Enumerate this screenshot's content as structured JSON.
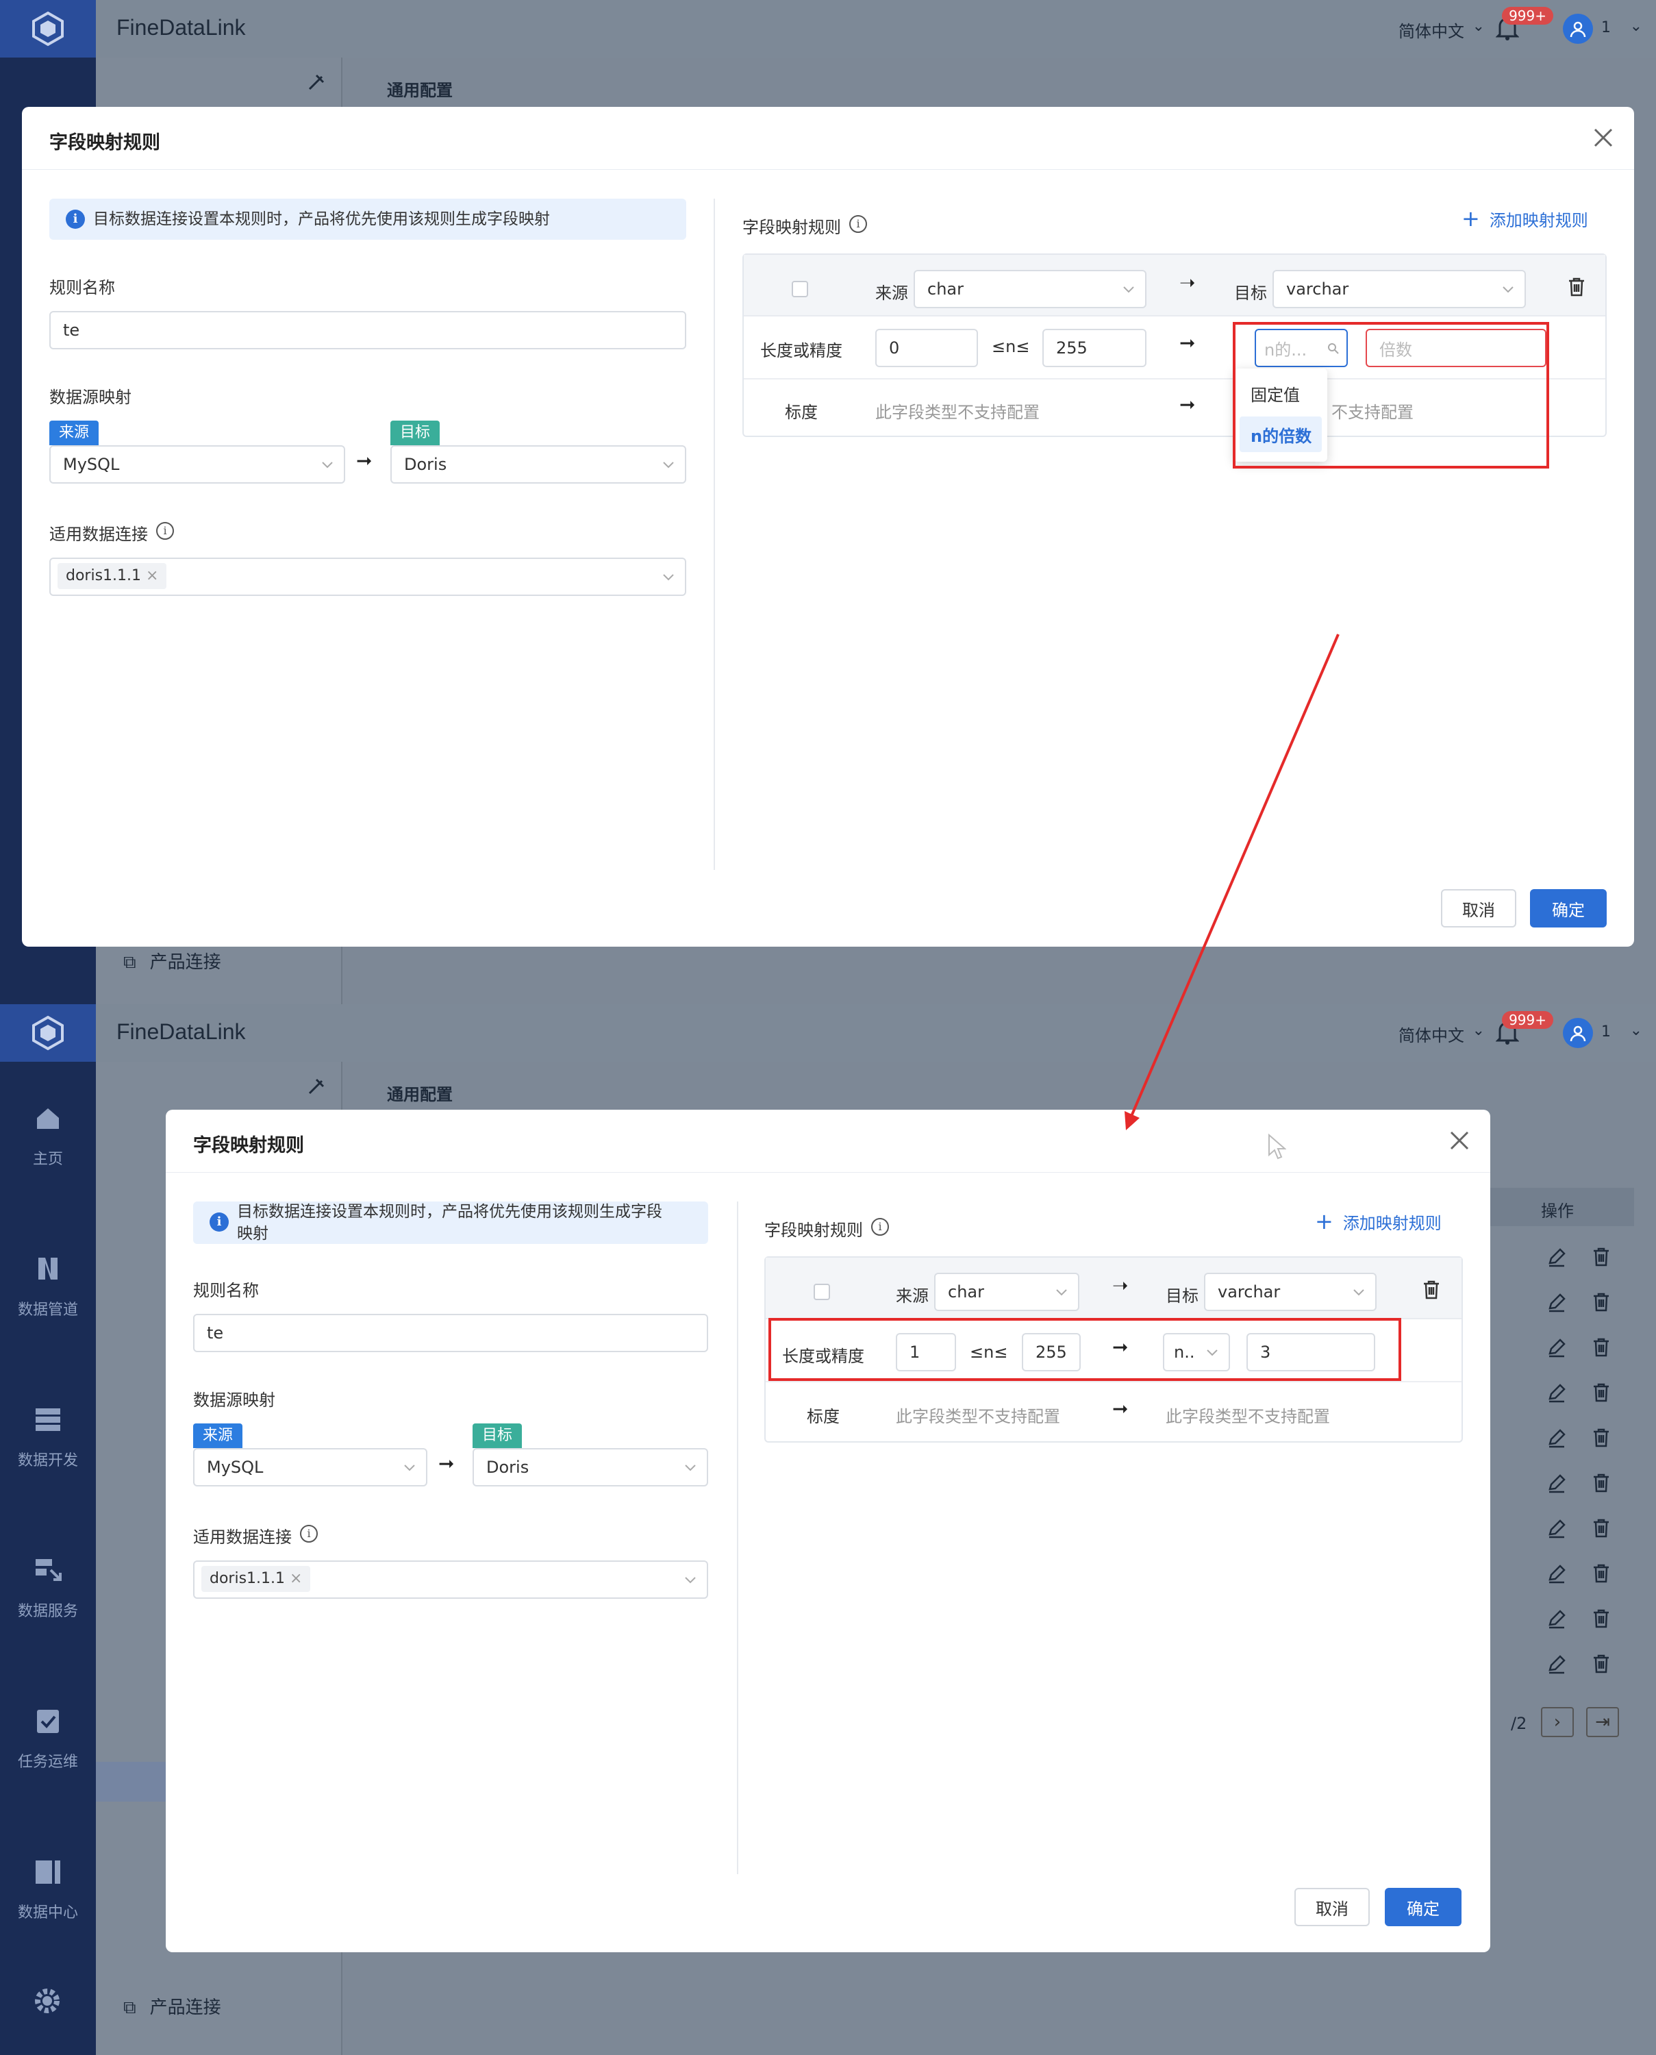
{
  "app": {
    "title": "FineDataLink",
    "language": "简体中文",
    "notification_badge": "999+",
    "user": "1"
  },
  "page": {
    "section_title": "通用配置",
    "product_connection": "产品连接"
  },
  "left_nav": [
    {
      "label": "主页",
      "icon": "home-icon"
    },
    {
      "label": "数据管道",
      "icon": "pipeline-icon"
    },
    {
      "label": "数据开发",
      "icon": "dev-icon"
    },
    {
      "label": "数据服务",
      "icon": "service-icon"
    },
    {
      "label": "任务运维",
      "icon": "ops-icon"
    },
    {
      "label": "数据中心",
      "icon": "datacenter-icon"
    }
  ],
  "modal": {
    "title": "字段映射规则",
    "info": "目标数据连接设置本规则时，产品将优先使用该规则生成字段映射",
    "info_line1": "目标数据连接设置本规则时，产品将优先使用该规则生成字段",
    "info_line2": "映射",
    "rule_name_label": "规则名称",
    "rule_name_value": "te",
    "ds_mapping_label": "数据源映射",
    "source_tag": "来源",
    "target_tag": "目标",
    "source_db": "MySQL",
    "target_db": "Doris",
    "conn_label": "适用数据连接",
    "conn_chip": "doris1.1.1",
    "field_rule_label": "字段映射规则",
    "add_rule": "添加映射规则",
    "cancel": "取消",
    "ok": "确定",
    "table": {
      "src_label": "来源",
      "tgt_label": "目标",
      "src_type": "char",
      "tgt_type": "varchar",
      "len_label": "长度或精度",
      "range_op": "≤n≤",
      "scale_label": "标度",
      "unsupported": "此字段类型不支持配置",
      "unsupported_partial": "不支持配置"
    }
  },
  "top_state": {
    "len_min": "0",
    "len_max": "255",
    "target_mode_placeholder": "n的...",
    "multiplier_placeholder": "倍数",
    "dropdown": [
      "固定值",
      "n的倍数"
    ]
  },
  "bottom_state": {
    "len_min": "1",
    "len_max": "255",
    "target_mode": "n..",
    "multiplier": "3",
    "ops_header": "操作",
    "pagination": "/2"
  },
  "colors": {
    "primary": "#2c6fd6",
    "highlight": "#e52a2a",
    "tag_green": "#3aae9a"
  }
}
